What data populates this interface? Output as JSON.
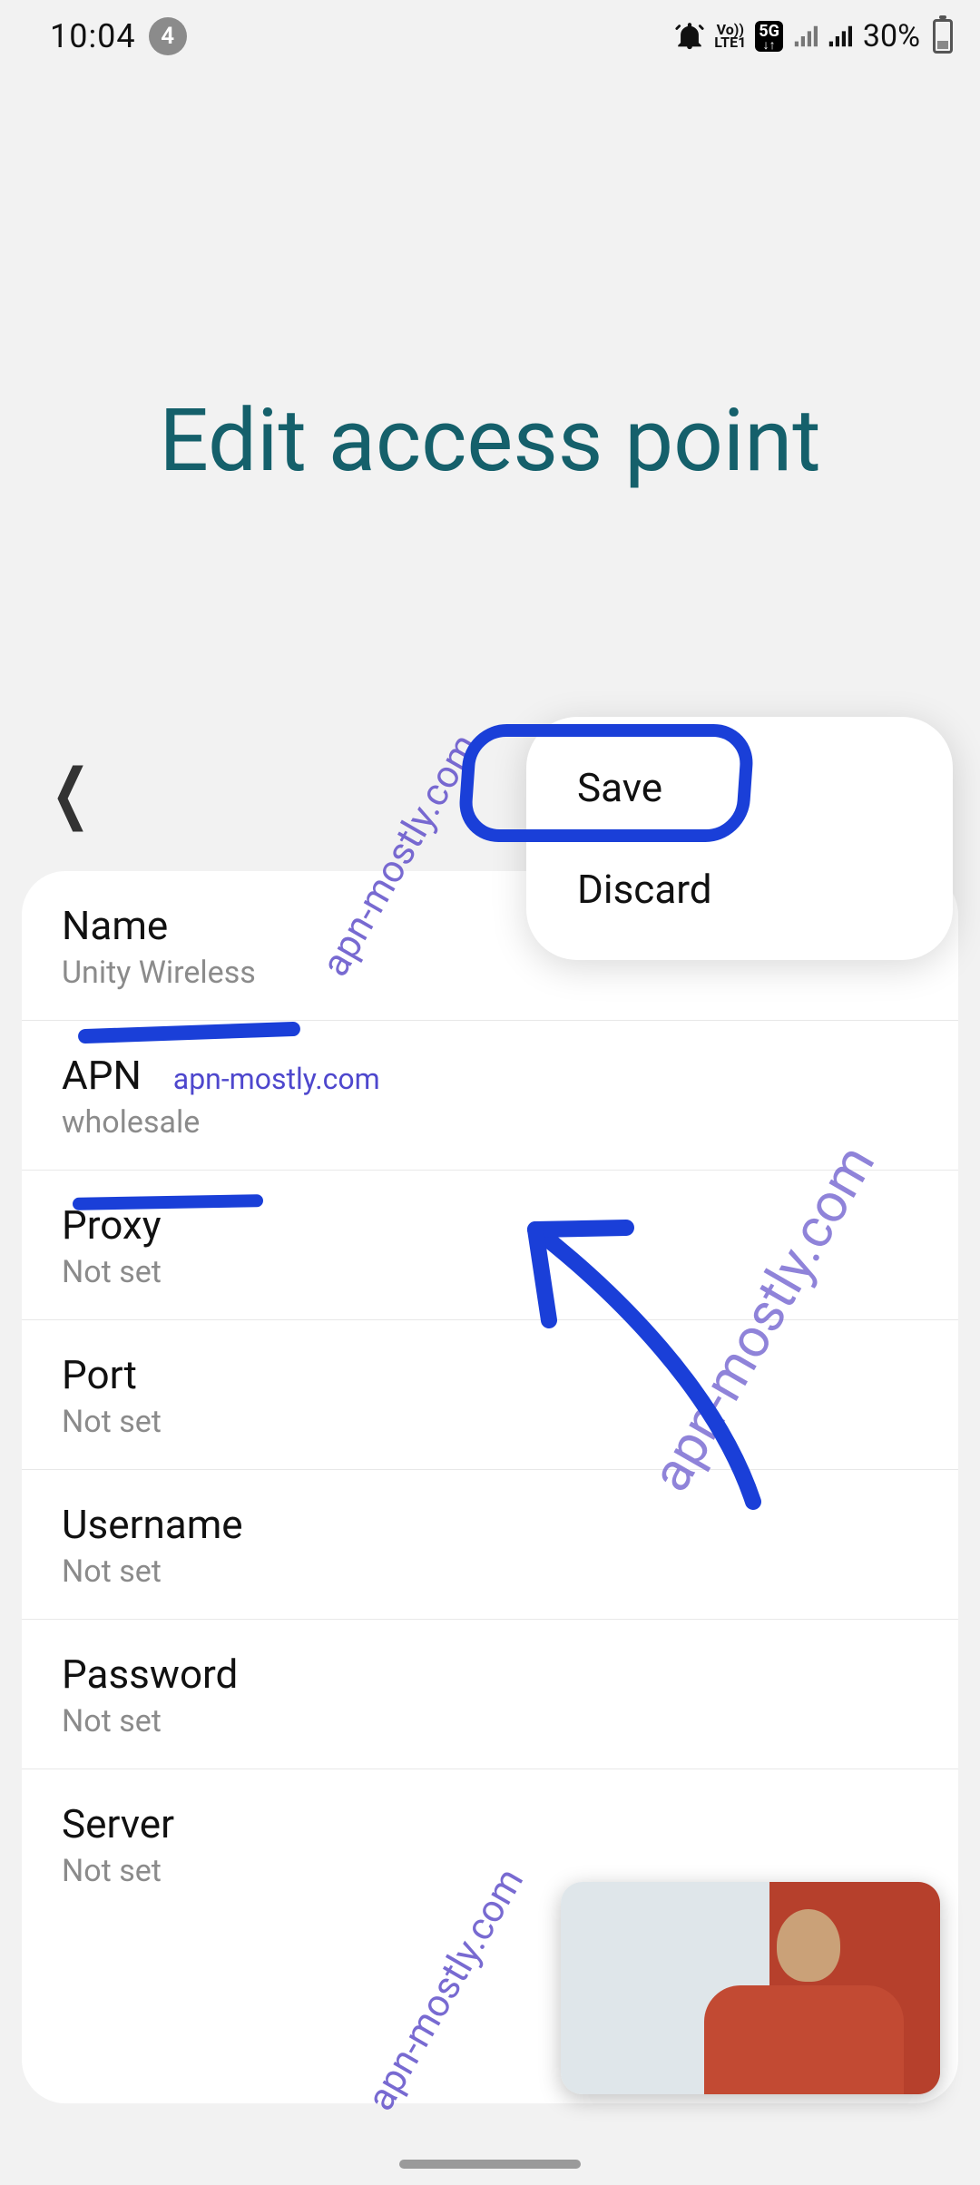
{
  "statusbar": {
    "time": "10:04",
    "notif_count": "4",
    "lte_top": "Vo))",
    "lte_bottom": "LTE1",
    "fiveg": "5G",
    "battery_pct": "30%"
  },
  "header": {
    "title": "Edit access point"
  },
  "menu": {
    "save": "Save",
    "discard": "Discard"
  },
  "fields": {
    "name": {
      "label": "Name",
      "value": "Unity Wireless"
    },
    "apn": {
      "label": "APN",
      "value": "wholesale"
    },
    "proxy": {
      "label": "Proxy",
      "value": "Not set"
    },
    "port": {
      "label": "Port",
      "value": "Not set"
    },
    "username": {
      "label": "Username",
      "value": "Not set"
    },
    "password": {
      "label": "Password",
      "value": "Not set"
    },
    "server": {
      "label": "Server",
      "value": "Not set"
    }
  },
  "watermark": "apn-mostly.com"
}
